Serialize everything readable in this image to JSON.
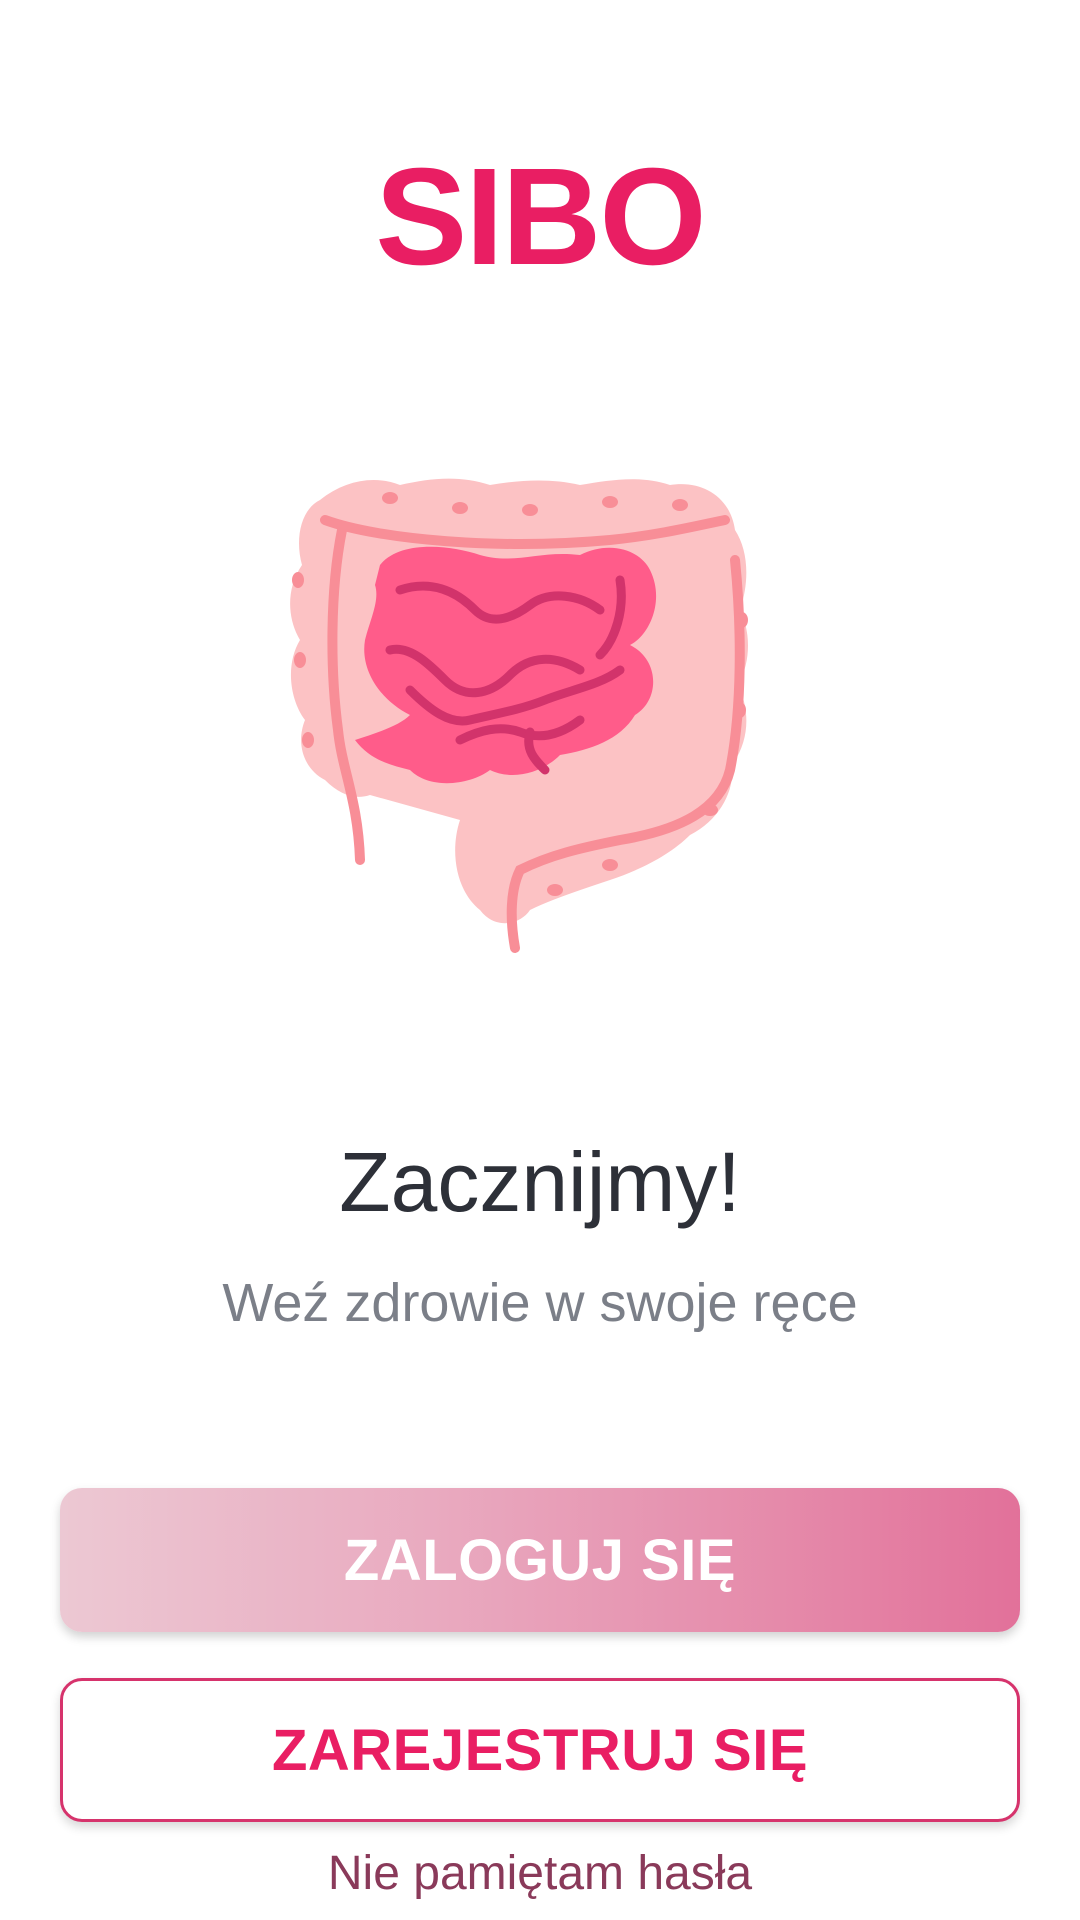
{
  "app": {
    "title": "SIBO"
  },
  "illustration": {
    "icon": "intestines-icon"
  },
  "welcome": {
    "headline": "Zacznijmy!",
    "subtitle": "Weź zdrowie w swoje ręce"
  },
  "actions": {
    "login_label": "ZALOGUJ SIĘ",
    "register_label": "ZAREJESTRUJ SIĘ",
    "forgot_password_label": "Nie pamiętam hasła"
  },
  "colors": {
    "brand": "#E91E63",
    "headline_text": "#2d3038",
    "subtitle_text": "#7b7f88",
    "link_text": "#8a3a5a",
    "login_gradient_start": "#ecc8d3",
    "login_gradient_end": "#e2719a",
    "illustration_outer": "#fcc2c4",
    "illustration_inner": "#ff5c8a"
  }
}
